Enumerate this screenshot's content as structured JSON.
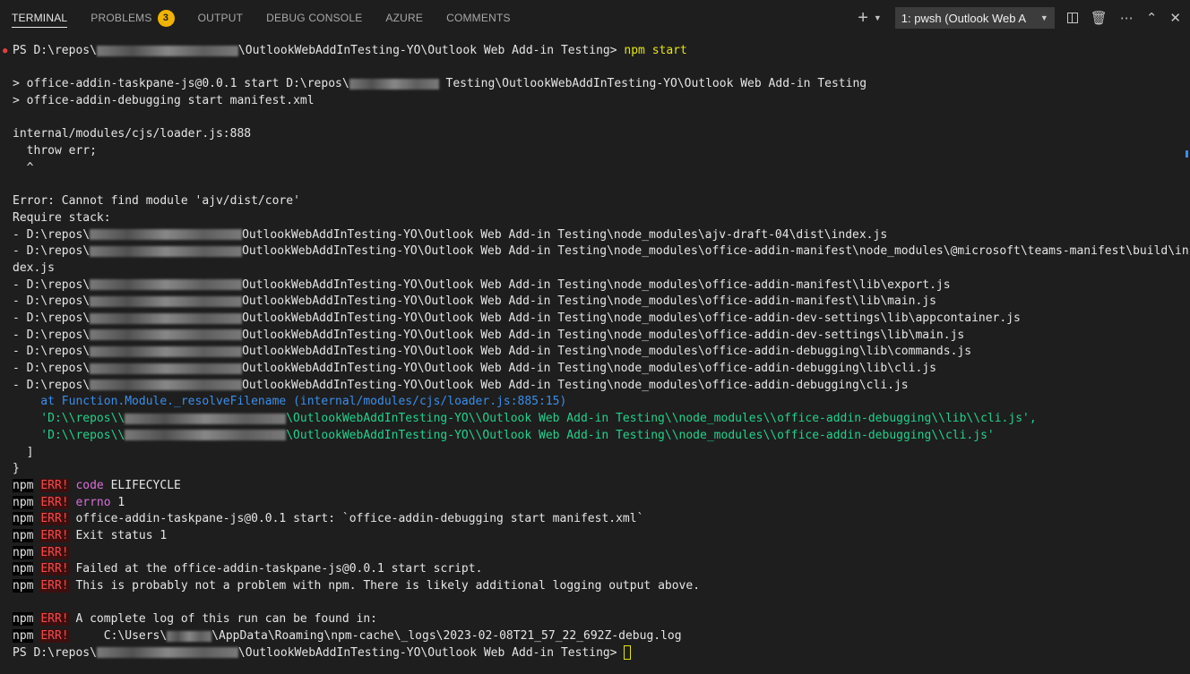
{
  "tabs": [
    {
      "label": "TERMINAL",
      "active": true
    },
    {
      "label": "PROBLEMS",
      "active": false,
      "badge": "3"
    },
    {
      "label": "OUTPUT",
      "active": false
    },
    {
      "label": "DEBUG CONSOLE",
      "active": false
    },
    {
      "label": "AZURE",
      "active": false
    },
    {
      "label": "COMMENTS",
      "active": false
    }
  ],
  "actions": {
    "new_terminal_icon": "plus-icon",
    "terminal_select_label": "1: pwsh (Outlook Web A",
    "split_icon": "split-icon",
    "kill_icon": "trash-icon",
    "more_icon": "ellipsis-icon",
    "maximize_icon": "chevron-up-icon",
    "close_icon": "close-icon"
  },
  "colors": {
    "background": "#1e1e1e",
    "badge": "#f0b400",
    "err_text": "#f14c4c",
    "green": "#23d18b",
    "blue": "#3b8eea",
    "yellow": "#e5e510"
  },
  "terminal": {
    "prompt_prefix": "PS D:\\repos\\",
    "prompt_suffix": "\\OutlookWebAddInTesting-YO\\Outlook Web Add-in Testing>",
    "command": "npm start",
    "cmd1_prefix": "> office-addin-taskpane-js@0.0.1 start D:\\repos\\",
    "cmd1_suffix": " Testing\\OutlookWebAddInTesting-YO\\Outlook Web Add-in Testing",
    "cmd2": "> office-addin-debugging start manifest.xml",
    "loader": "internal/modules/cjs/loader.js:888",
    "throw": "  throw err;",
    "caret": "  ^",
    "error_msg": "Error: Cannot find module 'ajv/dist/core'",
    "require_stack": "Require stack:",
    "stack_prefix": "- D:\\repos\\",
    "stack_mid": "OutlookWebAddInTesting-YO\\Outlook Web Add-in Testing\\node_modules\\",
    "stack": [
      "ajv-draft-04\\dist\\index.js",
      "office-addin-manifest\\node_modules\\@microsoft\\teams-manifest\\build\\in",
      "office-addin-manifest\\lib\\export.js",
      "office-addin-manifest\\lib\\main.js",
      "office-addin-dev-settings\\lib\\appcontainer.js",
      "office-addin-dev-settings\\lib\\main.js",
      "office-addin-debugging\\lib\\commands.js",
      "office-addin-debugging\\lib\\cli.js",
      "office-addin-debugging\\cli.js"
    ],
    "stack_wrap": "dex.js",
    "at_line": "    at Function.Module._resolveFilename (internal/modules/cjs/loader.js:885:15)",
    "quoted_prefix": "    'D:\\\\repos\\\\",
    "quoted_1": "\\OutlookWebAddInTesting-YO\\\\Outlook Web Add-in Testing\\\\node_modules\\\\office-addin-debugging\\\\lib\\\\cli.js',",
    "quoted_2": "\\OutlookWebAddInTesting-YO\\\\Outlook Web Add-in Testing\\\\node_modules\\\\office-addin-debugging\\\\cli.js'",
    "bracket": "  ]",
    "brace": "}",
    "npm": "npm",
    "err": "ERR!",
    "err_lines": [
      {
        "magenta": "code",
        "text": " ELIFECYCLE"
      },
      {
        "magenta": "errno",
        "text": " 1"
      },
      {
        "magenta": "",
        "text": " office-addin-taskpane-js@0.0.1 start: `office-addin-debugging start manifest.xml`"
      },
      {
        "magenta": "",
        "text": " Exit status 1"
      },
      {
        "magenta": "",
        "text": ""
      },
      {
        "magenta": "",
        "text": " Failed at the office-addin-taskpane-js@0.0.1 start script."
      },
      {
        "magenta": "",
        "text": " This is probably not a problem with npm. There is likely additional logging output above."
      }
    ],
    "log_line1": " A complete log of this run can be found in:",
    "log_line2_prefix": "     C:\\Users\\",
    "log_line2_suffix": "\\AppData\\Roaming\\npm-cache\\_logs\\2023-02-08T21_57_22_692Z-debug.log",
    "final_prompt_prefix": "PS D:\\repos\\",
    "final_prompt_suffix": "\\OutlookWebAddInTesting-YO\\Outlook Web Add-in Testing>"
  }
}
